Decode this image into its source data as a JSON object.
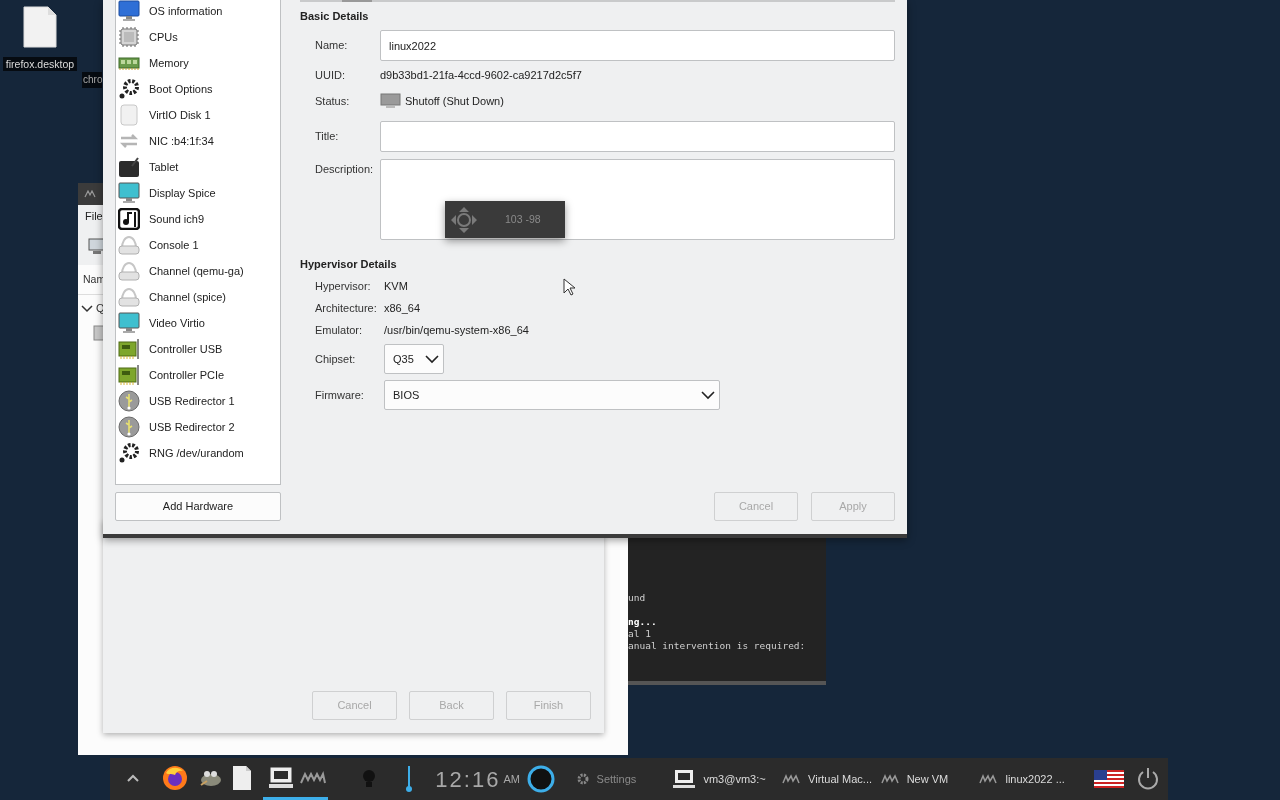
{
  "desktop_icons": [
    {
      "label": "firefox.desktop"
    },
    {
      "label": "chro"
    }
  ],
  "manager_window": {
    "menu": "File",
    "column_header": "Nam",
    "group": "Q"
  },
  "new_vm_dialog": {
    "buttons": [
      {
        "label": "Cancel",
        "disabled": true
      },
      {
        "label": "Back",
        "disabled": true
      },
      {
        "label": "Finish",
        "disabled": true
      }
    ]
  },
  "terminal": {
    "lines": [
      {
        "text": "und",
        "bold": false
      },
      {
        "text": "ng...",
        "bold": true
      },
      {
        "text": "al 1",
        "bold": false
      },
      {
        "text": "anual intervention is required:",
        "bold": false
      }
    ]
  },
  "details_window": {
    "hardware_list": [
      {
        "label": "OS information",
        "kind": "os"
      },
      {
        "label": "CPUs",
        "kind": "cpu"
      },
      {
        "label": "Memory",
        "kind": "memory"
      },
      {
        "label": "Boot Options",
        "kind": "gear"
      },
      {
        "label": "VirtIO Disk 1",
        "kind": "disk"
      },
      {
        "label": "NIC :b4:1f:34",
        "kind": "nic"
      },
      {
        "label": "Tablet",
        "kind": "tablet"
      },
      {
        "label": "Display Spice",
        "kind": "display"
      },
      {
        "label": "Sound ich9",
        "kind": "sound"
      },
      {
        "label": "Console 1",
        "kind": "serial"
      },
      {
        "label": "Channel (qemu-ga)",
        "kind": "serial"
      },
      {
        "label": "Channel (spice)",
        "kind": "serial"
      },
      {
        "label": "Video Virtio",
        "kind": "display"
      },
      {
        "label": "Controller USB",
        "kind": "controller"
      },
      {
        "label": "Controller PCIe",
        "kind": "controller"
      },
      {
        "label": "USB Redirector 1",
        "kind": "usb"
      },
      {
        "label": "USB Redirector 2",
        "kind": "usb"
      },
      {
        "label": "RNG /dev/urandom",
        "kind": "gear"
      }
    ],
    "add_hardware": "Add Hardware",
    "basic_details": {
      "heading": "Basic Details",
      "fields": [
        {
          "label": "Name:",
          "kind": "input",
          "value": "linux2022"
        },
        {
          "label": "UUID:",
          "kind": "text",
          "value": "d9b33bd1-21fa-4ccd-9602-ca9217d2c5f7"
        },
        {
          "label": "Status:",
          "kind": "status",
          "value": "Shutoff (Shut Down)"
        },
        {
          "label": "Title:",
          "kind": "input"
        },
        {
          "label": "Description:",
          "kind": "textarea"
        }
      ]
    },
    "hypervisor_details": {
      "heading": "Hypervisor Details",
      "fields": [
        {
          "label": "Hypervisor:",
          "kind": "text",
          "value": "KVM"
        },
        {
          "label": "Architecture:",
          "kind": "text",
          "value": "x86_64"
        },
        {
          "label": "Emulator:",
          "kind": "text",
          "value": "/usr/bin/qemu-system-x86_64"
        },
        {
          "label": "Chipset:",
          "kind": "select_small",
          "value": "Q35"
        },
        {
          "label": "Firmware:",
          "kind": "select_wide",
          "value": "BIOS"
        }
      ]
    },
    "buttons": [
      {
        "label": "Cancel",
        "disabled": true
      },
      {
        "label": "Apply",
        "disabled": true
      }
    ]
  },
  "move_hint": {
    "text": "103 -98"
  },
  "taskbar": {
    "launchers": [
      {
        "kind": "caret",
        "selected": false
      },
      {
        "kind": "firefox",
        "selected": false
      },
      {
        "kind": "gimp",
        "selected": false
      },
      {
        "kind": "file",
        "selected": false
      },
      {
        "kind": "computer",
        "selected": true
      },
      {
        "kind": "vm",
        "selected": true
      }
    ],
    "clock": {
      "time": "12:16",
      "period": "AM"
    },
    "tasks": [
      {
        "kind": "settings",
        "label": "Settings"
      },
      {
        "kind": "terminal",
        "label": "vm3@vm3:~"
      },
      {
        "kind": "vm",
        "label": "Virtual Mac..."
      },
      {
        "kind": "vm",
        "label": "New VM"
      },
      {
        "kind": "vm",
        "label": "linux2022 ..."
      }
    ]
  }
}
